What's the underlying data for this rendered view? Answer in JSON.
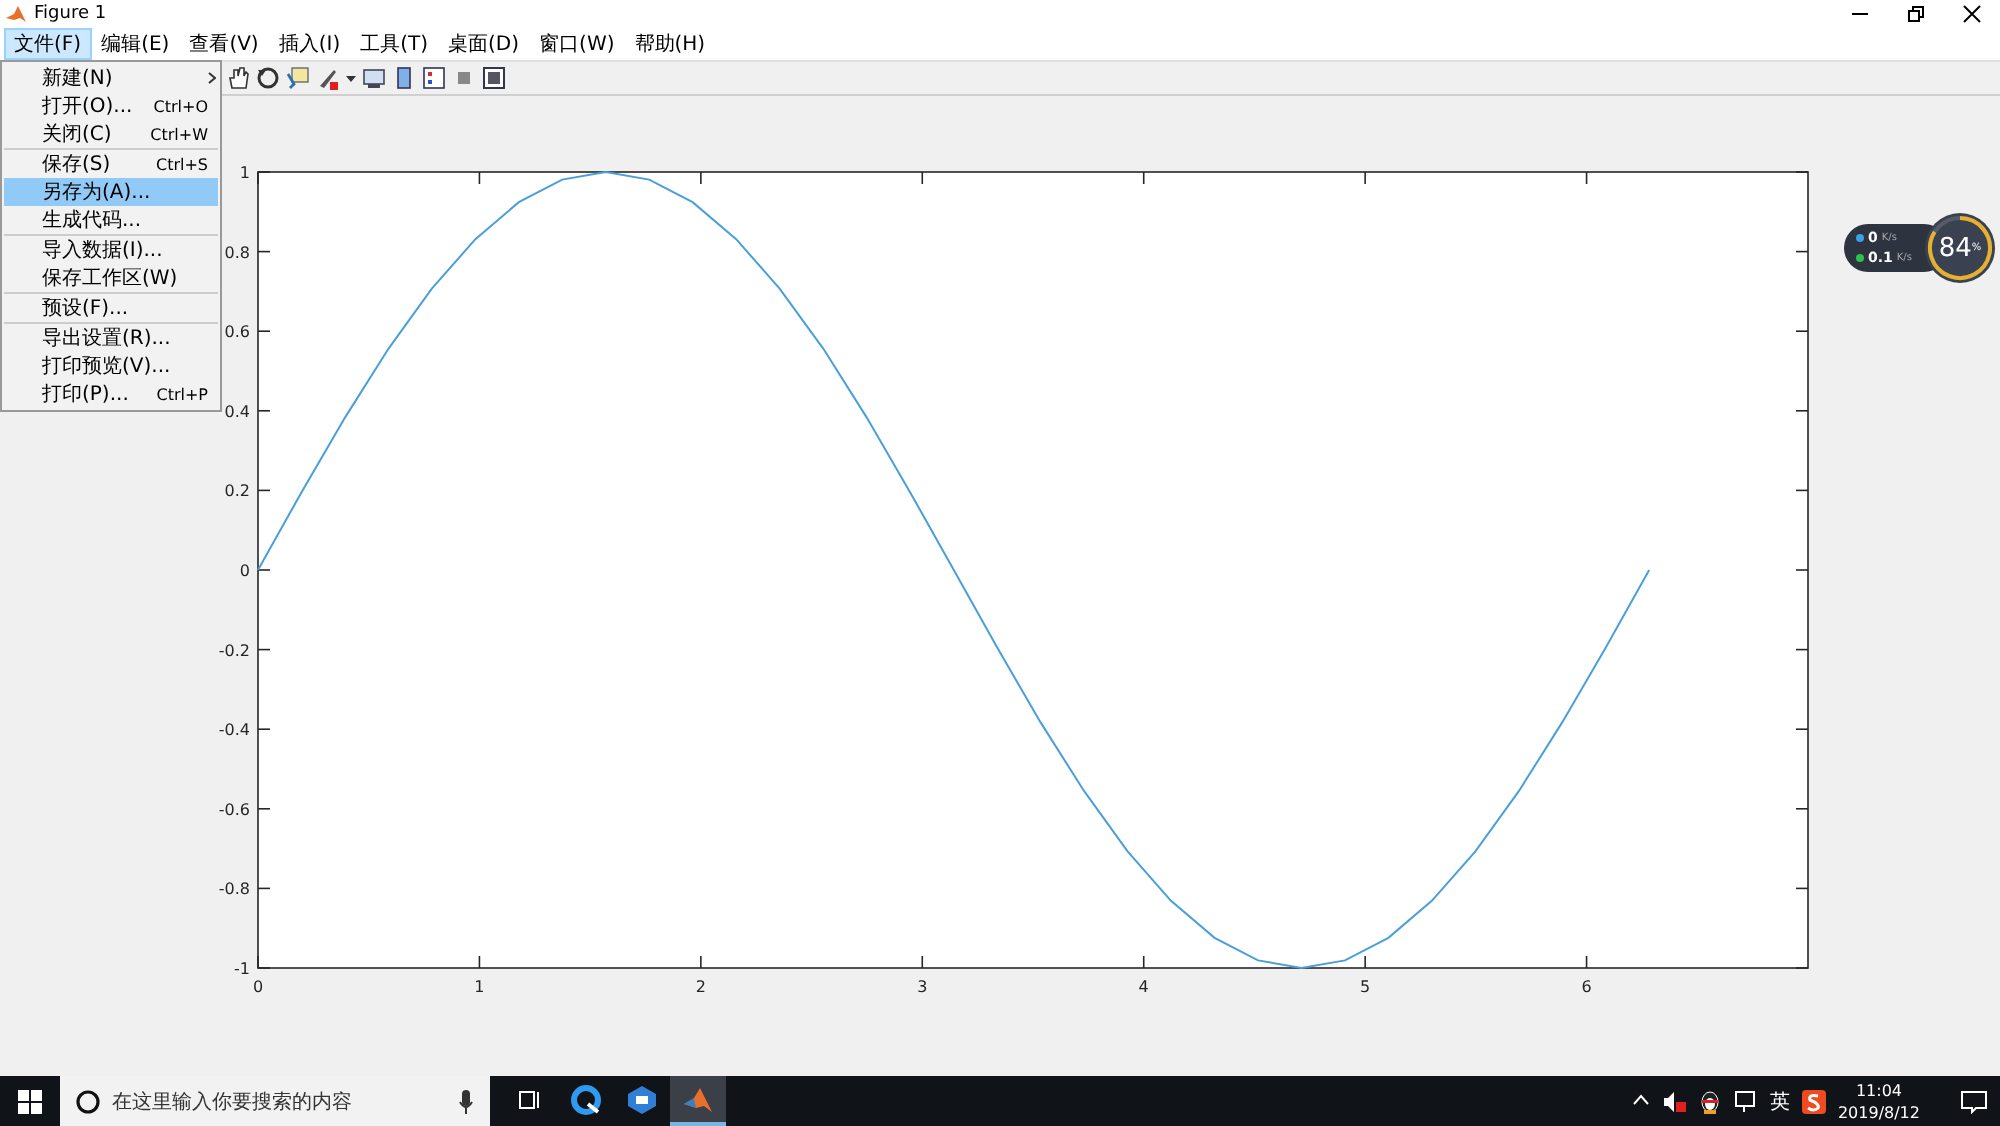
{
  "window": {
    "title": "Figure 1"
  },
  "menu_bar": [
    {
      "label": "文件(F)",
      "selected": true
    },
    {
      "label": "编辑(E)",
      "selected": false
    },
    {
      "label": "查看(V)",
      "selected": false
    },
    {
      "label": "插入(I)",
      "selected": false
    },
    {
      "label": "工具(T)",
      "selected": false
    },
    {
      "label": "桌面(D)",
      "selected": false
    },
    {
      "label": "窗口(W)",
      "selected": false
    },
    {
      "label": "帮助(H)",
      "selected": false
    }
  ],
  "file_menu": {
    "groups": [
      {
        "items": [
          {
            "label": "新建(N)",
            "has_submenu": true,
            "selected": false
          },
          {
            "label": "打开(O)...",
            "shortcut": "Ctrl+O",
            "has_submenu": false,
            "selected": false
          },
          {
            "label": "关闭(C)",
            "shortcut": "Ctrl+W",
            "has_submenu": false,
            "selected": false
          }
        ]
      },
      {
        "items": [
          {
            "label": "保存(S)",
            "shortcut": "Ctrl+S",
            "has_submenu": false,
            "selected": false
          },
          {
            "label": "另存为(A)...",
            "has_submenu": false,
            "selected": true
          },
          {
            "label": "生成代码...",
            "has_submenu": false,
            "selected": false
          }
        ]
      },
      {
        "items": [
          {
            "label": "导入数据(I)...",
            "has_submenu": false,
            "selected": false
          },
          {
            "label": "保存工作区(W)",
            "has_submenu": false,
            "selected": false
          }
        ]
      },
      {
        "items": [
          {
            "label": "预设(F)...",
            "has_submenu": false,
            "selected": false
          }
        ]
      },
      {
        "items": [
          {
            "label": "导出设置(R)...",
            "has_submenu": false,
            "selected": false
          },
          {
            "label": "打印预览(V)...",
            "has_submenu": false,
            "selected": false
          },
          {
            "label": "打印(P)...",
            "shortcut": "Ctrl+P",
            "has_submenu": false,
            "selected": false
          }
        ]
      }
    ]
  },
  "chart_data": {
    "type": "line",
    "xlim": [
      0,
      7
    ],
    "ylim": [
      -1,
      1
    ],
    "xticks": [
      0,
      1,
      2,
      3,
      4,
      5,
      6
    ],
    "yticks": [
      -1,
      -0.8,
      -0.6,
      -0.4,
      -0.2,
      0,
      0.2,
      0.4,
      0.6,
      0.8,
      1
    ],
    "x": [
      0,
      0.196,
      0.393,
      0.589,
      0.785,
      0.982,
      1.178,
      1.374,
      1.571,
      1.767,
      1.963,
      2.16,
      2.356,
      2.553,
      2.749,
      2.945,
      3.142,
      3.338,
      3.534,
      3.731,
      3.927,
      4.123,
      4.32,
      4.516,
      4.712,
      4.909,
      5.105,
      5.301,
      5.498,
      5.694,
      5.89,
      6.087,
      6.283
    ],
    "series": [
      {
        "color": "#4a9fd8",
        "values": [
          0,
          0.195,
          0.383,
          0.556,
          0.707,
          0.831,
          0.924,
          0.981,
          1,
          0.981,
          0.924,
          0.831,
          0.707,
          0.556,
          0.383,
          0.195,
          0,
          -0.195,
          -0.383,
          -0.556,
          -0.707,
          -0.831,
          -0.924,
          -0.981,
          -1,
          -0.981,
          -0.924,
          -0.831,
          -0.707,
          -0.556,
          -0.383,
          -0.195,
          0
        ]
      }
    ]
  },
  "net_widget": {
    "upload": "0",
    "upload_unit": "K/s",
    "download": "0.1",
    "download_unit": "K/s",
    "percent": "84",
    "percent_unit": "%",
    "level": 0.84
  },
  "taskbar": {
    "search": {
      "placeholder": "在这里输入你要搜索的内容"
    },
    "apps": [
      {
        "kind": "browser",
        "selected": false
      },
      {
        "kind": "tool",
        "selected": false
      },
      {
        "kind": "matlab",
        "selected": true
      }
    ],
    "input_method": "英",
    "time": "11:04",
    "date": "2019/8/12"
  }
}
